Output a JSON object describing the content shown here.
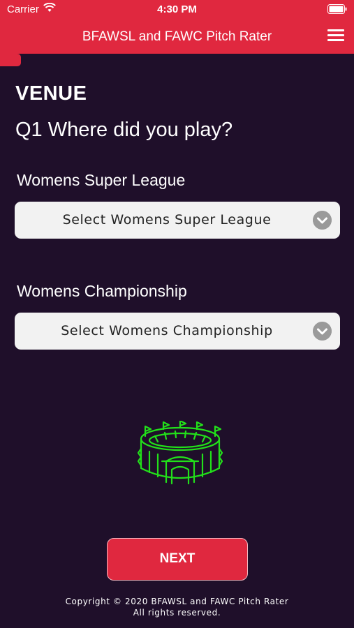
{
  "status_bar": {
    "carrier": "Carrier",
    "time": "4:30 PM"
  },
  "header": {
    "title": "BFAWSL and FAWC Pitch Rater"
  },
  "progress": {
    "fraction": 0.06
  },
  "main": {
    "section_heading": "VENUE",
    "question": "Q1 Where did you play?",
    "wsl": {
      "label": "Womens Super League",
      "selected": "Select Womens Super League"
    },
    "wc": {
      "label": "Womens Championship",
      "selected": "Select Womens Championship"
    }
  },
  "footer": {
    "next_label": "NEXT",
    "copyright_line1": "Copyright © 2020 BFAWSL and FAWC Pitch Rater",
    "copyright_line2": "All rights reserved."
  },
  "colors": {
    "accent": "#e0283f",
    "background": "#1f0f2a",
    "stadium": "#22e01a"
  },
  "icons": {
    "menu": "hamburger-menu-icon",
    "select": "chevron-down-icon",
    "illustration": "stadium-icon"
  }
}
